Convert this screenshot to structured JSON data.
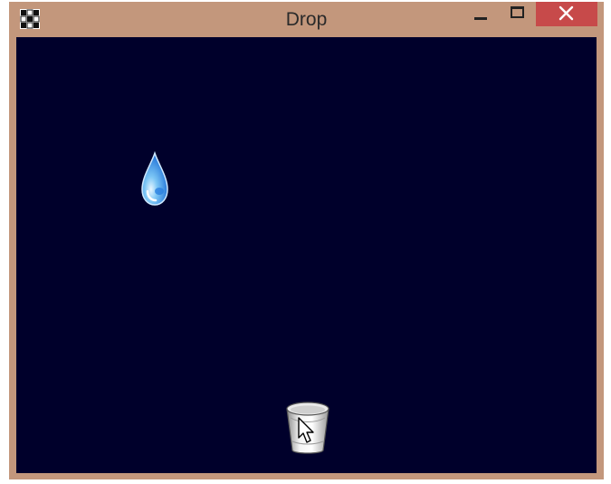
{
  "window": {
    "title": "Drop",
    "icon": "app-grid-icon",
    "controls": [
      "minimize-icon",
      "maximize-icon",
      "close-icon"
    ],
    "frame_color": "#c3977c",
    "close_color": "#c74a4a"
  },
  "game": {
    "background_color": "#00002b",
    "objects": [
      "raindrop",
      "bucket"
    ]
  }
}
